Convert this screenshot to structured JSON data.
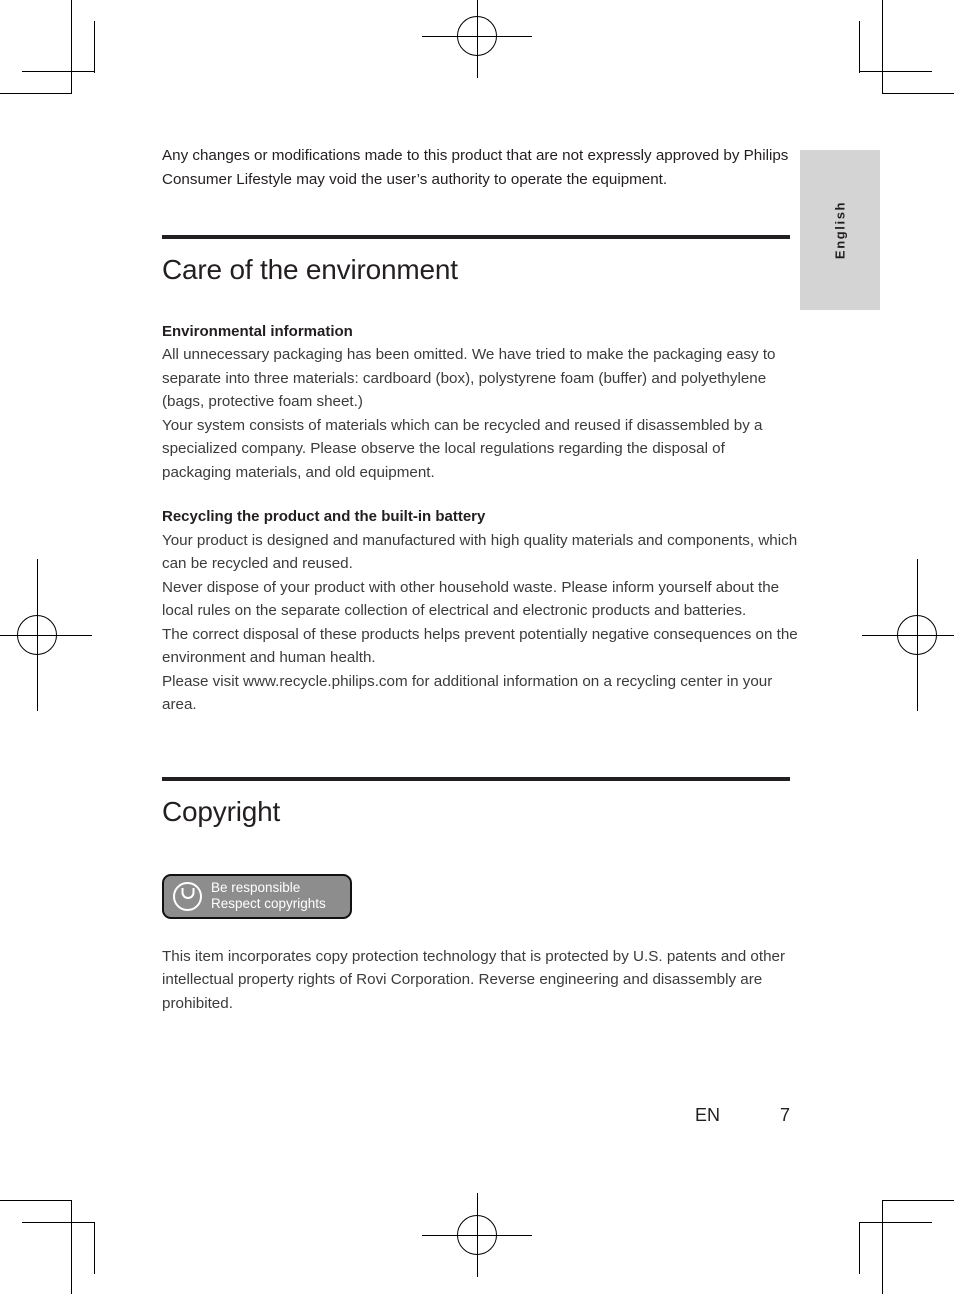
{
  "page": {
    "language_tab": "English",
    "footer_language": "EN",
    "footer_page_number": "7"
  },
  "intro": {
    "text": "Any changes or modifications made to this product that are not expressly approved by Philips Consumer Lifestyle may void the user’s authority to operate the equipment."
  },
  "sections": [
    {
      "title": "Care of the environment",
      "subsections": [
        {
          "heading": "Environmental information",
          "paragraphs": [
            "All unnecessary packaging has been omitted. We have tried to make the packaging easy to separate into three materials: cardboard (box), polystyrene foam (buffer) and polyethylene (bags, protective foam sheet.)",
            "Your system consists of materials which can be recycled and reused if disassembled by a specialized company. Please observe the local regulations regarding the disposal of packaging materials, and old equipment."
          ]
        },
        {
          "heading": "Recycling the product and the built-in battery",
          "paragraphs": [
            "Your product is designed and manufactured with high quality materials and components, which can be recycled and reused.",
            "Never dispose of your product with other household waste. Please inform yourself about the local rules on the separate collection of electrical and electronic products and batteries.",
            "The correct disposal of these products helps prevent potentially negative consequences on the environment and human health.",
            "Please visit www.recycle.philips.com for additional information on a recycling center in your area."
          ]
        }
      ]
    },
    {
      "title": "Copyright",
      "badge": {
        "icon": "power-circle-icon",
        "line1": "Be responsible",
        "line2": "Respect copyrights"
      },
      "paragraphs": [
        "This item incorporates copy protection technology that is protected by U.S. patents and other intellectual property rights of Rovi Corporation. Reverse engineering and disassembly are prohibited."
      ]
    }
  ],
  "colors": {
    "text": "#231f20",
    "body_text": "#3b3b3b",
    "rule": "#231f20",
    "tab_background": "#d4d4d4",
    "badge_background": "#8d8d8d",
    "badge_border": "#111111"
  }
}
